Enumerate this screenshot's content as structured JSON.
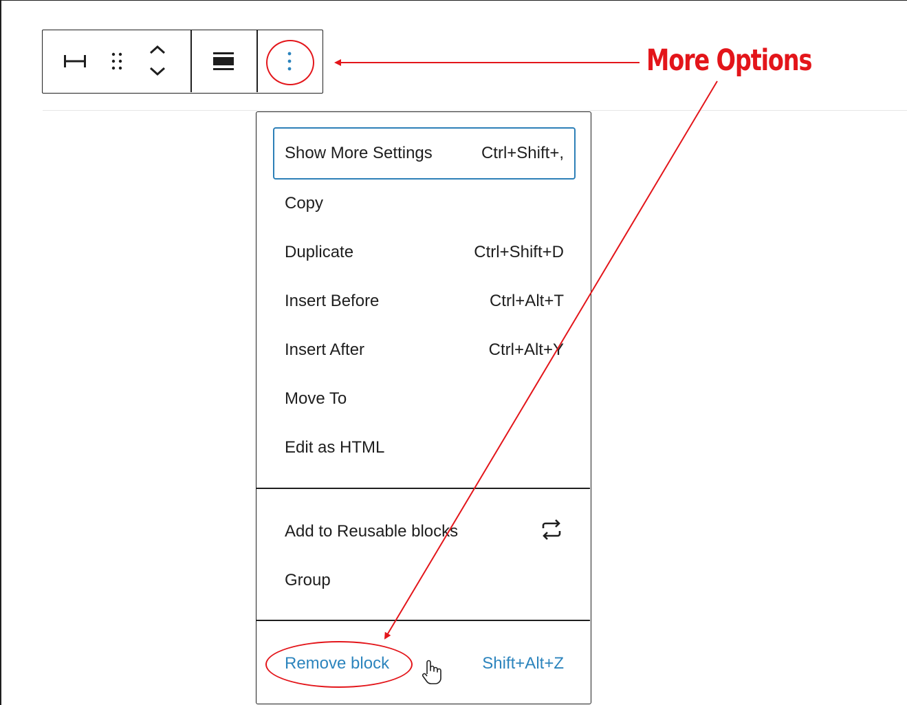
{
  "toolbar": {
    "icons": {
      "width": "horizontal-resize-icon",
      "drag": "drag-handle-icon",
      "move": "move-up-down-icon",
      "align": "align-icon",
      "options": "vertical-ellipsis-icon"
    }
  },
  "annotation": {
    "label": "More Options",
    "color": "#e3151a"
  },
  "menu": {
    "section1": [
      {
        "label": "Show More Settings",
        "shortcut": "Ctrl+Shift+,",
        "focused": true
      },
      {
        "label": "Copy",
        "shortcut": ""
      },
      {
        "label": "Duplicate",
        "shortcut": "Ctrl+Shift+D"
      },
      {
        "label": "Insert Before",
        "shortcut": "Ctrl+Alt+T"
      },
      {
        "label": "Insert After",
        "shortcut": "Ctrl+Alt+Y"
      },
      {
        "label": "Move To",
        "shortcut": ""
      },
      {
        "label": "Edit as HTML",
        "shortcut": ""
      }
    ],
    "section2": [
      {
        "label": "Add to Reusable blocks",
        "icon": "reusable-block-icon"
      },
      {
        "label": "Group"
      }
    ],
    "section3": [
      {
        "label": "Remove block",
        "shortcut": "Shift+Alt+Z"
      }
    ]
  },
  "colors": {
    "accent": "#2c84bd",
    "focus_border": "#2c7fb7",
    "annotation": "#e3151a",
    "text": "#1e1e1e"
  }
}
